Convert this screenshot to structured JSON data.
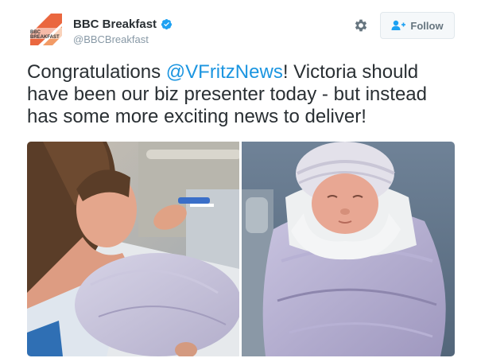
{
  "account": {
    "display_name": "BBC Breakfast",
    "handle": "@BBCBreakfast",
    "avatar_icon": "bbc-breakfast-logo",
    "avatar_logo_text": [
      "BBC",
      "BREAKFAST"
    ],
    "verified_icon": "verified-badge-icon",
    "brand_color": "#e8562a"
  },
  "actions": {
    "settings_icon": "gear-icon",
    "follow_label": "Follow",
    "follow_icon": "add-user-icon"
  },
  "tweet": {
    "text_before_mention": "Congratulations ",
    "mention": "@VFritzNews",
    "text_after_mention": "! Victoria should have been our biz presenter today - but instead has some more exciting news to deliver!",
    "mention_color": "#1b95e0"
  },
  "media": {
    "photos": [
      {
        "subject": "mother-holding-newborn-photo"
      },
      {
        "subject": "swaddled-newborn-photo"
      }
    ]
  }
}
